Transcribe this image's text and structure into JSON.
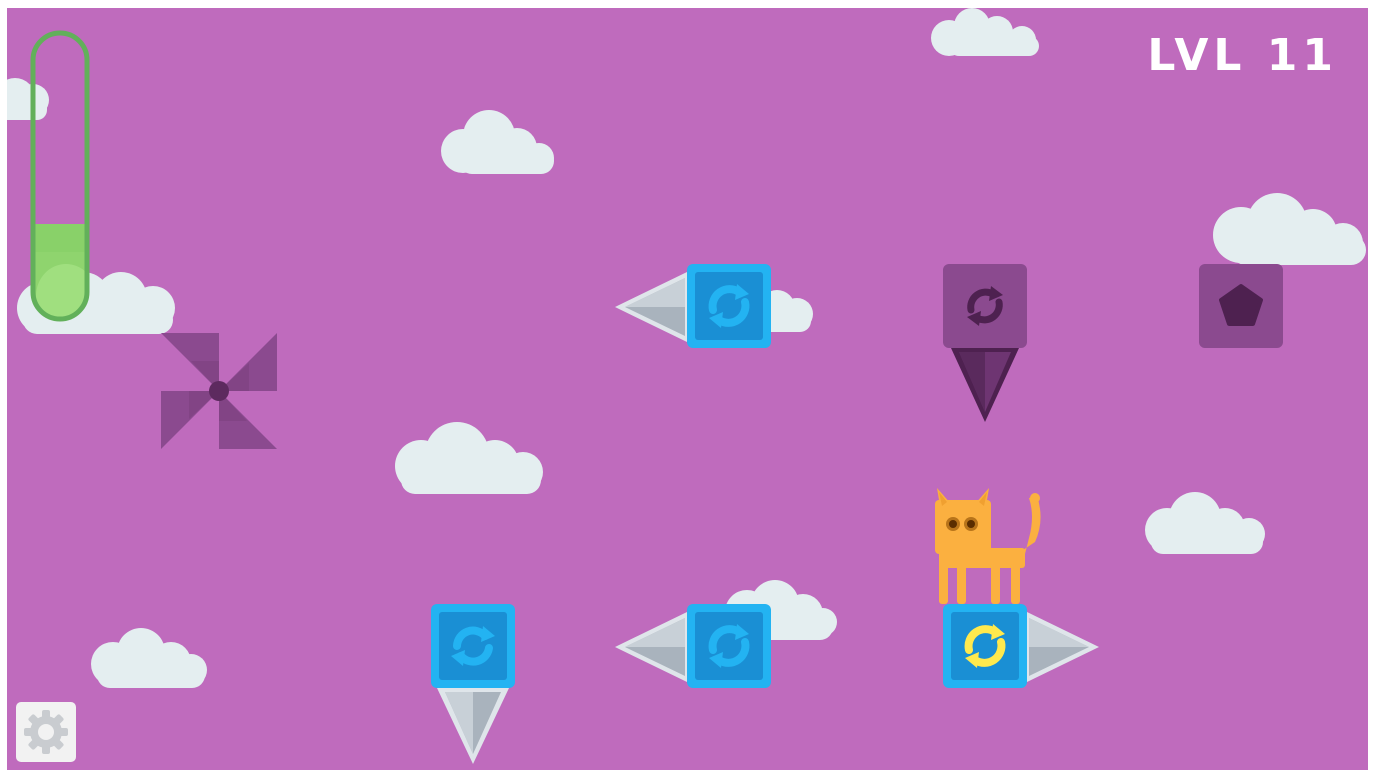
{
  "hud": {
    "level_label": "LVL 11",
    "meter_fill_fraction": 0.33
  },
  "colors": {
    "background": "#bf6bbd",
    "cloud": "#e4eef0",
    "blue_block_border": "#23b3f2",
    "blue_block_fill": "#1a8fd4",
    "purple_block": "#8b4a8f",
    "meter_border": "#62b05a",
    "meter_fill": "#9fe07e",
    "cat": "#fbb040",
    "spike_steel": "#a9b3bd",
    "rotate_arrows_blue": "#23b3f2",
    "rotate_arrows_yellow": "#ffe94d"
  },
  "icons": {
    "settings": "gear-icon",
    "rotate": "rotate-arrows-icon",
    "goal": "pentagon-icon",
    "fan": "pinwheel-icon",
    "player": "cat-icon"
  }
}
